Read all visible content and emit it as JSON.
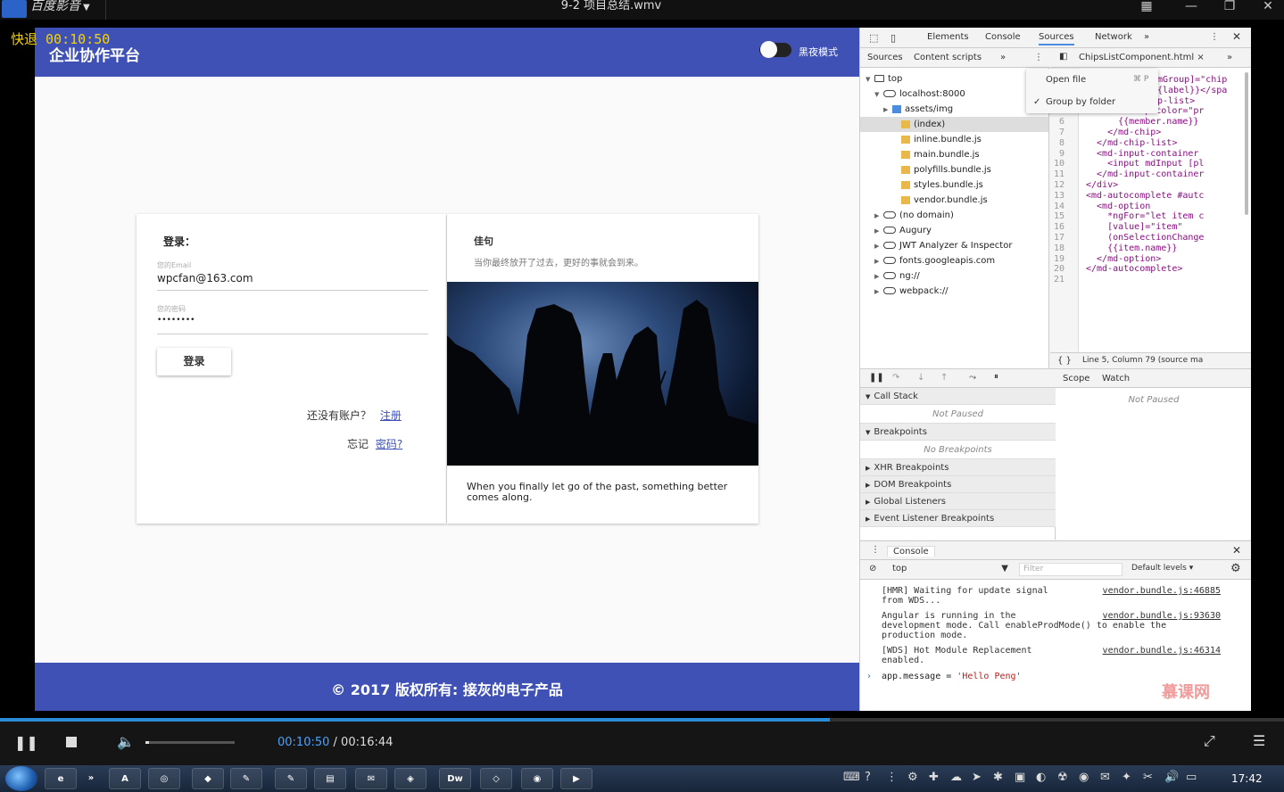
{
  "player": {
    "app_name": "百度影音",
    "file_title": "9-2 项目总结.wmv",
    "osd": "快退 00:10:50",
    "current_time": "00:10:50",
    "total_time": "/ 00:16:44",
    "progress_fraction": 0.646,
    "volume_fraction": 0.04
  },
  "app": {
    "title": "企业协作平台",
    "dark_mode_label": "黑夜模式",
    "footer": "© 2017 版权所有: 接灰的电子产品"
  },
  "login": {
    "heading": "登录：",
    "email_label": "您的Email",
    "email_value": "wpcfan@163.com",
    "password_label": "您的密码",
    "password_value": "••••••••",
    "button": "登录",
    "no_account": "还没有账户？",
    "register": "注册",
    "forgot": "忘记",
    "password_link": "密码?"
  },
  "quote": {
    "title": "佳句",
    "cn": "当你最终放开了过去，更好的事就会到来。",
    "en": "When you finally let go of the past, something better comes along."
  },
  "devtools": {
    "tabs": [
      "Elements",
      "Console",
      "Sources",
      "Network",
      "»"
    ],
    "active_tab": "Sources",
    "nav_tabs": [
      "Sources",
      "Content scripts",
      "»"
    ],
    "file_tab": "ChipsListComponent.html",
    "menu": {
      "open_file": "Open file",
      "shortcut": "⌘ P",
      "group_by_folder": "Group by folder"
    },
    "tree": [
      {
        "label": "top",
        "kind": "frame",
        "indent": 0,
        "arrow": "▼"
      },
      {
        "label": "localhost:8000",
        "kind": "cloud",
        "indent": 1,
        "arrow": "▼"
      },
      {
        "label": "assets/img",
        "kind": "folder-blue",
        "indent": 2,
        "arrow": "▶"
      },
      {
        "label": "(index)",
        "kind": "file",
        "indent": 3,
        "arrow": ""
      },
      {
        "label": "inline.bundle.js",
        "kind": "file",
        "indent": 3,
        "arrow": ""
      },
      {
        "label": "main.bundle.js",
        "kind": "file",
        "indent": 3,
        "arrow": ""
      },
      {
        "label": "polyfills.bundle.js",
        "kind": "file",
        "indent": 3,
        "arrow": ""
      },
      {
        "label": "styles.bundle.js",
        "kind": "file",
        "indent": 3,
        "arrow": ""
      },
      {
        "label": "vendor.bundle.js",
        "kind": "file",
        "indent": 3,
        "arrow": ""
      },
      {
        "label": "(no domain)",
        "kind": "cloud",
        "indent": 1,
        "arrow": "▶"
      },
      {
        "label": "Augury",
        "kind": "cloud",
        "indent": 1,
        "arrow": "▶"
      },
      {
        "label": "JWT Analyzer & Inspector",
        "kind": "cloud",
        "indent": 1,
        "arrow": "▶"
      },
      {
        "label": "fonts.googleapis.com",
        "kind": "cloud",
        "indent": 1,
        "arrow": "▶"
      },
      {
        "label": "ng://",
        "kind": "cloud",
        "indent": 1,
        "arrow": "▶"
      },
      {
        "label": "webpack://",
        "kind": "cloud",
        "indent": 1,
        "arrow": "▶"
      }
    ],
    "code_lines": [
      {
        "n": "",
        "t": "mGroup]=\"chip"
      },
      {
        "n": "",
        "t": "{label}}</spa"
      },
      {
        "n": "",
        "t": "p-list>"
      },
      {
        "n": "5",
        "t": "    <md-chip color=\"pr"
      },
      {
        "n": "6",
        "t": "      {{member.name}}"
      },
      {
        "n": "7",
        "t": "    </md-chip>"
      },
      {
        "n": "8",
        "t": "  </md-chip-list>"
      },
      {
        "n": "9",
        "t": "  <md-input-container"
      },
      {
        "n": "10",
        "t": "    <input mdInput [pl"
      },
      {
        "n": "11",
        "t": "  </md-input-container"
      },
      {
        "n": "12",
        "t": "</div>"
      },
      {
        "n": "13",
        "t": "<md-autocomplete #autc"
      },
      {
        "n": "14",
        "t": "  <md-option"
      },
      {
        "n": "15",
        "t": "    *ngFor=\"let item c"
      },
      {
        "n": "16",
        "t": "    [value]=\"item\""
      },
      {
        "n": "17",
        "t": "    (onSelectionChange"
      },
      {
        "n": "18",
        "t": "    {{item.name}}"
      },
      {
        "n": "19",
        "t": "  </md-option>"
      },
      {
        "n": "20",
        "t": "</md-autocomplete>"
      },
      {
        "n": "21",
        "t": ""
      }
    ],
    "status": "Line 5, Column 79  (source ma",
    "debug_sections": [
      {
        "title": "Call Stack",
        "open": true,
        "empty": "Not Paused"
      },
      {
        "title": "Breakpoints",
        "open": true,
        "empty": "No Breakpoints"
      },
      {
        "title": "XHR Breakpoints",
        "open": false,
        "empty": ""
      },
      {
        "title": "DOM Breakpoints",
        "open": false,
        "empty": ""
      },
      {
        "title": "Global Listeners",
        "open": false,
        "empty": ""
      },
      {
        "title": "Event Listener Breakpoints",
        "open": false,
        "empty": ""
      }
    ],
    "scope_tabs": [
      "Scope",
      "Watch"
    ],
    "scope_empty": "Not Paused",
    "console_title": "Console",
    "console_context": "top",
    "console_filter": "Filter",
    "console_levels": "Default levels ▾",
    "console_lines": [
      {
        "text": "[HMR] Waiting for update signal\nfrom WDS...",
        "src": "vendor.bundle.js:46885"
      },
      {
        "text": "Angular is running in the\ndevelopment mode. Call enableProdMode() to enable the\nproduction mode.",
        "src": "vendor.bundle.js:93630"
      },
      {
        "text": "[WDS] Hot Module Replacement\nenabled.",
        "src": "vendor.bundle.js:46314"
      }
    ],
    "console_input_left": "app.message = ",
    "console_input_right": "'Hello Peng'",
    "watermark": "慕课网"
  },
  "taskbar": {
    "items": [
      "e",
      "»",
      "A",
      "◎",
      "◆",
      "✎",
      "✎",
      "▤",
      "✉",
      "◈",
      "Dw",
      "◇",
      "◉",
      "▶"
    ],
    "tray": [
      "⌨",
      "?",
      "⋮",
      "⚙",
      "✚",
      "☁",
      "➤",
      "✱",
      "▣",
      "◐",
      "☢",
      "◉",
      "✉",
      "✦",
      "✂",
      "🔊",
      "▭"
    ],
    "clock": "17:42"
  }
}
